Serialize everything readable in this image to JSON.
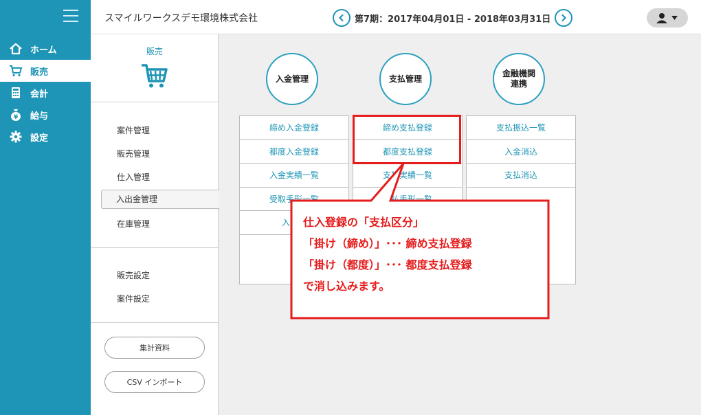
{
  "nav": {
    "items": [
      {
        "label": "ホーム",
        "icon": "home-icon"
      },
      {
        "label": "販売",
        "icon": "cart-icon"
      },
      {
        "label": "会計",
        "icon": "calculator-icon"
      },
      {
        "label": "給与",
        "icon": "money-bag-icon"
      },
      {
        "label": "設定",
        "icon": "gear-icon"
      }
    ]
  },
  "header": {
    "company": "スマイルワークスデモ環境株式会社",
    "period": "第7期：2017年04月01日 - 2018年03月31日"
  },
  "subpanel": {
    "title": "販売",
    "items": [
      "案件管理",
      "販売管理",
      "仕入管理",
      "入出金管理",
      "在庫管理"
    ],
    "settings": [
      "販売設定",
      "案件設定"
    ],
    "buttons": [
      "集計資料",
      "CSV インポート"
    ]
  },
  "main": {
    "circles": [
      "入金管理",
      "支払管理",
      "金融機関",
      "連携"
    ],
    "col1": [
      "締め入金登録",
      "都度入金登録",
      "入金実績一覧",
      "受取手形一覧",
      "入金予"
    ],
    "col2": [
      "締め支払登録",
      "都度支払登録",
      "支払実績一覧",
      "支払手形一覧"
    ],
    "col3": [
      "支払振込一覧",
      "入金消込",
      "支払消込"
    ]
  },
  "callout": {
    "lines": [
      "仕入登録の「支払区分」",
      "「掛け（締め）」･･･ 締め支払登録",
      "「掛け（都度）」･･･ 都度支払登録",
      "で消し込みます。"
    ]
  },
  "colors": {
    "accent": "#1e95b6",
    "callout": "#e51c1c"
  }
}
